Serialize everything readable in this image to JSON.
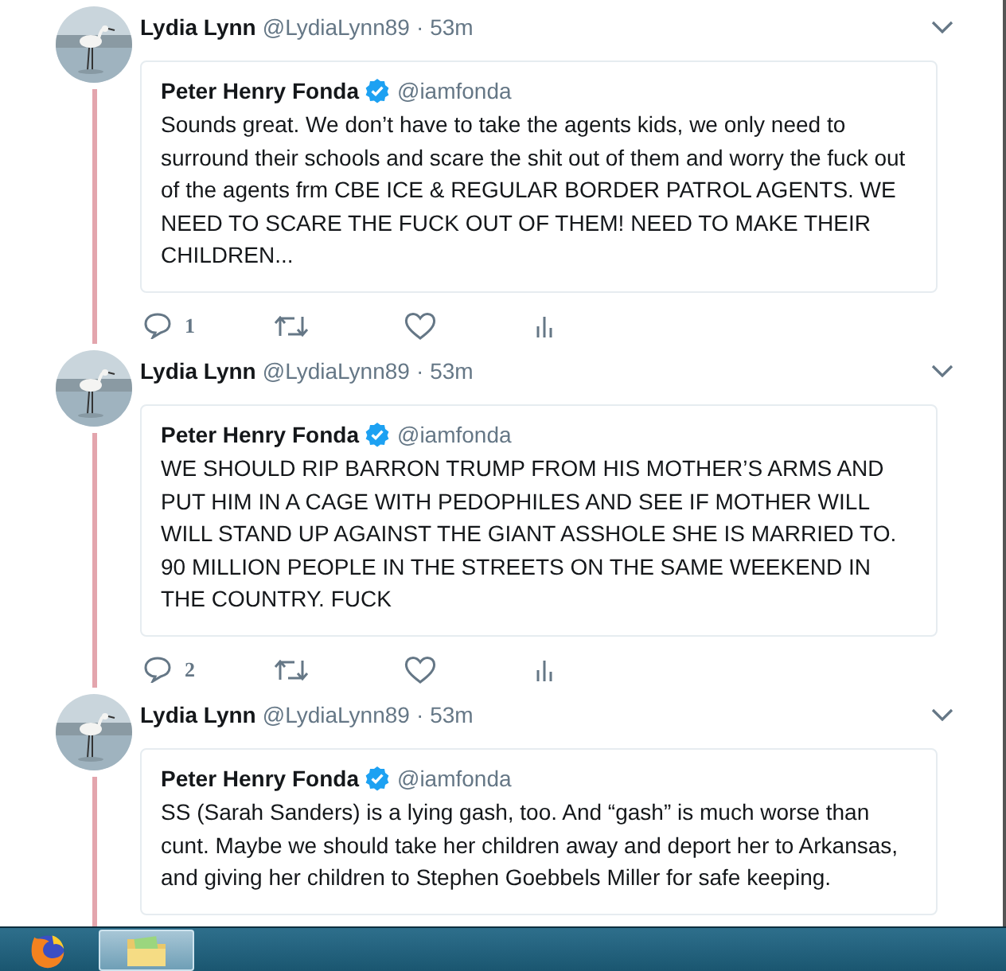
{
  "tweets": [
    {
      "author": "Lydia Lynn",
      "handle": "@LydiaLynn89",
      "separator": "·",
      "time": "53m",
      "thread_line": true,
      "quote": {
        "author": "Peter Henry Fonda",
        "verified": true,
        "handle": "@iamfonda",
        "text": "Sounds great. We don’t have to take the agents kids, we only need to surround their schools and scare the shit out of them and worry the fuck out of the agents frm CBE ICE & REGULAR BORDER PATROL AGENTS. WE NEED TO SCARE THE FUCK OUT OF THEM! NEED TO MAKE THEIR CHILDREN..."
      },
      "actions": {
        "reply_count": "1"
      }
    },
    {
      "author": "Lydia Lynn",
      "handle": "@LydiaLynn89",
      "separator": "·",
      "time": "53m",
      "thread_line": true,
      "quote": {
        "author": "Peter Henry Fonda",
        "verified": true,
        "handle": "@iamfonda",
        "text": "WE SHOULD RIP BARRON TRUMP FROM HIS MOTHER’S ARMS AND PUT HIM IN A CAGE WITH PEDOPHILES AND SEE IF MOTHER WILL WILL STAND UP AGAINST THE GIANT ASSHOLE SHE IS MARRIED TO. 90 MILLION PEOPLE IN THE STREETS ON THE SAME WEEKEND IN THE COUNTRY. FUCK"
      },
      "actions": {
        "reply_count": "2"
      }
    },
    {
      "author": "Lydia Lynn",
      "handle": "@LydiaLynn89",
      "separator": "·",
      "time": "53m",
      "thread_line": true,
      "quote": {
        "author": "Peter Henry Fonda",
        "verified": true,
        "handle": "@iamfonda",
        "text": "SS (Sarah Sanders) is a lying gash, too. And “gash” is much worse than cunt. Maybe we should take her children away and deport her to Arkansas, and giving her children to Stephen Goebbels Miller for safe keeping."
      }
    }
  ],
  "taskbar": {
    "items": [
      {
        "kind": "browser",
        "selected": false
      },
      {
        "kind": "folder",
        "selected": true
      }
    ]
  }
}
